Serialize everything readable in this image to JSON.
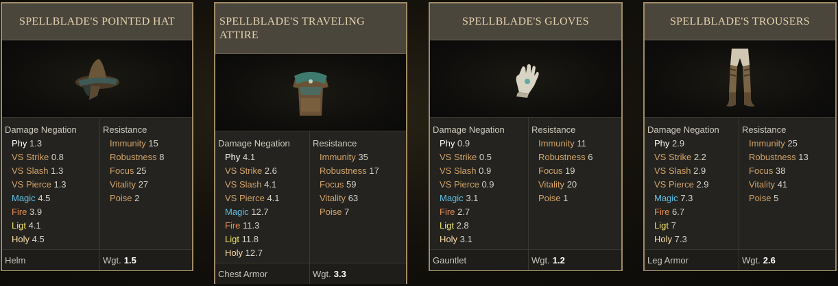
{
  "cards": [
    {
      "title": "Spellblade's Pointed Hat",
      "icon": "pointed-hat-icon",
      "dn_label": "Damage Negation",
      "res_label": "Resistance",
      "dn": [
        {
          "label": "Phy",
          "value": "1.3"
        },
        {
          "label": "VS Strike",
          "value": "0.8"
        },
        {
          "label": "VS Slash",
          "value": "1.3"
        },
        {
          "label": "VS Pierce",
          "value": "1.3"
        },
        {
          "label": "Magic",
          "value": "4.5"
        },
        {
          "label": "Fire",
          "value": "3.9"
        },
        {
          "label": "Ligt",
          "value": "4.1"
        },
        {
          "label": "Holy",
          "value": "4.5"
        }
      ],
      "res": [
        {
          "label": "Immunity",
          "value": "15"
        },
        {
          "label": "Robustness",
          "value": "8"
        },
        {
          "label": "Focus",
          "value": "25"
        },
        {
          "label": "Vitality",
          "value": "27"
        },
        {
          "label": "Poise",
          "value": "2"
        }
      ],
      "type": "Helm",
      "wgt_label": "Wgt.",
      "wgt": "1.5"
    },
    {
      "title": "Spellblade's Traveling Attire",
      "icon": "chest-armor-icon",
      "dn_label": "Damage Negation",
      "res_label": "Resistance",
      "dn": [
        {
          "label": "Phy",
          "value": "4.1"
        },
        {
          "label": "VS Strike",
          "value": "2.6"
        },
        {
          "label": "VS Slash",
          "value": "4.1"
        },
        {
          "label": "VS Pierce",
          "value": "4.1"
        },
        {
          "label": "Magic",
          "value": "12.7"
        },
        {
          "label": "Fire",
          "value": "11.3"
        },
        {
          "label": "Ligt",
          "value": "11.8"
        },
        {
          "label": "Holy",
          "value": "12.7"
        }
      ],
      "res": [
        {
          "label": "Immunity",
          "value": "35"
        },
        {
          "label": "Robustness",
          "value": "17"
        },
        {
          "label": "Focus",
          "value": "59"
        },
        {
          "label": "Vitality",
          "value": "63"
        },
        {
          "label": "Poise",
          "value": "7"
        }
      ],
      "type": "Chest Armor",
      "wgt_label": "Wgt.",
      "wgt": "3.3"
    },
    {
      "title": "Spellblade's Gloves",
      "icon": "glove-icon",
      "dn_label": "Damage Negation",
      "res_label": "Resistance",
      "dn": [
        {
          "label": "Phy",
          "value": "0.9"
        },
        {
          "label": "VS Strike",
          "value": "0.5"
        },
        {
          "label": "VS Slash",
          "value": "0.9"
        },
        {
          "label": "VS Pierce",
          "value": "0.9"
        },
        {
          "label": "Magic",
          "value": "3.1"
        },
        {
          "label": "Fire",
          "value": "2.7"
        },
        {
          "label": "Ligt",
          "value": "2.8"
        },
        {
          "label": "Holy",
          "value": "3.1"
        }
      ],
      "res": [
        {
          "label": "Immunity",
          "value": "11"
        },
        {
          "label": "Robustness",
          "value": "6"
        },
        {
          "label": "Focus",
          "value": "19"
        },
        {
          "label": "Vitality",
          "value": "20"
        },
        {
          "label": "Poise",
          "value": "1"
        }
      ],
      "type": "Gauntlet",
      "wgt_label": "Wgt.",
      "wgt": "1.2"
    },
    {
      "title": "Spellblade's Trousers",
      "icon": "trousers-icon",
      "dn_label": "Damage Negation",
      "res_label": "Resistance",
      "dn": [
        {
          "label": "Phy",
          "value": "2.9"
        },
        {
          "label": "VS Strike",
          "value": "2.2"
        },
        {
          "label": "VS Slash",
          "value": "2.9"
        },
        {
          "label": "VS Pierce",
          "value": "2.9"
        },
        {
          "label": "Magic",
          "value": "7.3"
        },
        {
          "label": "Fire",
          "value": "6.7"
        },
        {
          "label": "Ligt",
          "value": "7"
        },
        {
          "label": "Holy",
          "value": "7.3"
        }
      ],
      "res": [
        {
          "label": "Immunity",
          "value": "25"
        },
        {
          "label": "Robustness",
          "value": "13"
        },
        {
          "label": "Focus",
          "value": "38"
        },
        {
          "label": "Vitality",
          "value": "41"
        },
        {
          "label": "Poise",
          "value": "5"
        }
      ],
      "type": "Leg Armor",
      "wgt_label": "Wgt.",
      "wgt": "2.6"
    }
  ]
}
